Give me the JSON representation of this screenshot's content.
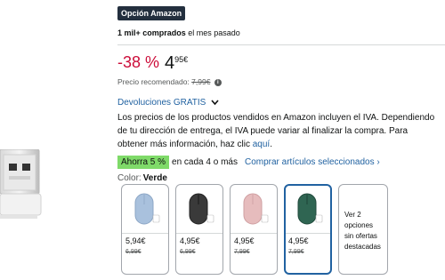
{
  "badge": "Opción Amazon",
  "bought": {
    "bold": "1 mil+ comprados",
    "rest": " el mes pasado"
  },
  "price": {
    "discount": "-38 %",
    "whole": "4",
    "fraction": "95",
    "currency": "€"
  },
  "recommended": {
    "label": "Precio recomendado: ",
    "value": "7,99€"
  },
  "returns": {
    "label": "Devoluciones GRATIS"
  },
  "vat": {
    "line1": "Los precios de los productos vendidos en Amazon incluyen el IVA. Dependiendo",
    "line2": "de tu dirección de entrega, el IVA puede variar al finalizar la compra. Para",
    "line3_prefix": "obtener más información, haz clic ",
    "line3_link": "aquí",
    "line3_suffix": "."
  },
  "promo": {
    "badge": "Ahorra 5 %",
    "text": "en cada 4 o más",
    "link": "Comprar artículos seleccionados ›"
  },
  "color": {
    "label": "Color:",
    "value": "Verde"
  },
  "variants": [
    {
      "name": "Azul",
      "price": "5,94€",
      "old": "6,99€",
      "mouse_color": "#a9c1dd",
      "selected": false
    },
    {
      "name": "Negro",
      "price": "4,95€",
      "old": "6,99€",
      "mouse_color": "#3a3a3a",
      "selected": false
    },
    {
      "name": "Rosa",
      "price": "4,95€",
      "old": "7,99€",
      "mouse_color": "#e6bcbd",
      "selected": false
    },
    {
      "name": "Verde",
      "price": "4,95€",
      "old": "7,99€",
      "mouse_color": "#2f6552",
      "selected": true
    }
  ],
  "more_options": {
    "line1": "Ver 2",
    "line2": "opciones",
    "line3": "sin ofertas",
    "line4": "destacadas"
  },
  "colors": {
    "accent_link": "#2162a1",
    "discount": "#cc0c39",
    "promo_green": "#7fda69",
    "badge_bg": "#232f3e"
  }
}
